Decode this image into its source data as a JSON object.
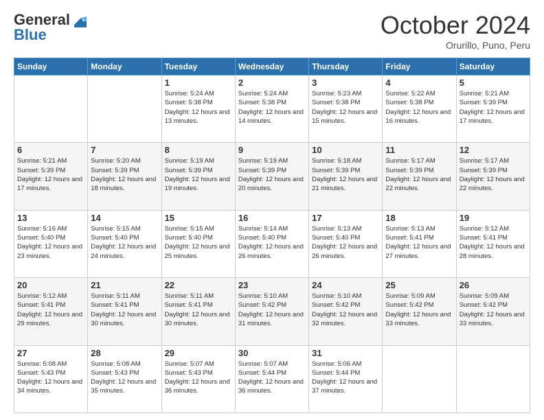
{
  "logo": {
    "line1": "General",
    "line2": "Blue"
  },
  "header": {
    "month": "October 2024",
    "location": "Orurillo, Puno, Peru"
  },
  "weekdays": [
    "Sunday",
    "Monday",
    "Tuesday",
    "Wednesday",
    "Thursday",
    "Friday",
    "Saturday"
  ],
  "weeks": [
    [
      {
        "day": "",
        "info": ""
      },
      {
        "day": "",
        "info": ""
      },
      {
        "day": "1",
        "info": "Sunrise: 5:24 AM\nSunset: 5:38 PM\nDaylight: 12 hours and 13 minutes."
      },
      {
        "day": "2",
        "info": "Sunrise: 5:24 AM\nSunset: 5:38 PM\nDaylight: 12 hours and 14 minutes."
      },
      {
        "day": "3",
        "info": "Sunrise: 5:23 AM\nSunset: 5:38 PM\nDaylight: 12 hours and 15 minutes."
      },
      {
        "day": "4",
        "info": "Sunrise: 5:22 AM\nSunset: 5:38 PM\nDaylight: 12 hours and 16 minutes."
      },
      {
        "day": "5",
        "info": "Sunrise: 5:21 AM\nSunset: 5:39 PM\nDaylight: 12 hours and 17 minutes."
      }
    ],
    [
      {
        "day": "6",
        "info": "Sunrise: 5:21 AM\nSunset: 5:39 PM\nDaylight: 12 hours and 17 minutes."
      },
      {
        "day": "7",
        "info": "Sunrise: 5:20 AM\nSunset: 5:39 PM\nDaylight: 12 hours and 18 minutes."
      },
      {
        "day": "8",
        "info": "Sunrise: 5:19 AM\nSunset: 5:39 PM\nDaylight: 12 hours and 19 minutes."
      },
      {
        "day": "9",
        "info": "Sunrise: 5:19 AM\nSunset: 5:39 PM\nDaylight: 12 hours and 20 minutes."
      },
      {
        "day": "10",
        "info": "Sunrise: 5:18 AM\nSunset: 5:39 PM\nDaylight: 12 hours and 21 minutes."
      },
      {
        "day": "11",
        "info": "Sunrise: 5:17 AM\nSunset: 5:39 PM\nDaylight: 12 hours and 22 minutes."
      },
      {
        "day": "12",
        "info": "Sunrise: 5:17 AM\nSunset: 5:39 PM\nDaylight: 12 hours and 22 minutes."
      }
    ],
    [
      {
        "day": "13",
        "info": "Sunrise: 5:16 AM\nSunset: 5:40 PM\nDaylight: 12 hours and 23 minutes."
      },
      {
        "day": "14",
        "info": "Sunrise: 5:15 AM\nSunset: 5:40 PM\nDaylight: 12 hours and 24 minutes."
      },
      {
        "day": "15",
        "info": "Sunrise: 5:15 AM\nSunset: 5:40 PM\nDaylight: 12 hours and 25 minutes."
      },
      {
        "day": "16",
        "info": "Sunrise: 5:14 AM\nSunset: 5:40 PM\nDaylight: 12 hours and 26 minutes."
      },
      {
        "day": "17",
        "info": "Sunrise: 5:13 AM\nSunset: 5:40 PM\nDaylight: 12 hours and 26 minutes."
      },
      {
        "day": "18",
        "info": "Sunrise: 5:13 AM\nSunset: 5:41 PM\nDaylight: 12 hours and 27 minutes."
      },
      {
        "day": "19",
        "info": "Sunrise: 5:12 AM\nSunset: 5:41 PM\nDaylight: 12 hours and 28 minutes."
      }
    ],
    [
      {
        "day": "20",
        "info": "Sunrise: 5:12 AM\nSunset: 5:41 PM\nDaylight: 12 hours and 29 minutes."
      },
      {
        "day": "21",
        "info": "Sunrise: 5:11 AM\nSunset: 5:41 PM\nDaylight: 12 hours and 30 minutes."
      },
      {
        "day": "22",
        "info": "Sunrise: 5:11 AM\nSunset: 5:41 PM\nDaylight: 12 hours and 30 minutes."
      },
      {
        "day": "23",
        "info": "Sunrise: 5:10 AM\nSunset: 5:42 PM\nDaylight: 12 hours and 31 minutes."
      },
      {
        "day": "24",
        "info": "Sunrise: 5:10 AM\nSunset: 5:42 PM\nDaylight: 12 hours and 32 minutes."
      },
      {
        "day": "25",
        "info": "Sunrise: 5:09 AM\nSunset: 5:42 PM\nDaylight: 12 hours and 33 minutes."
      },
      {
        "day": "26",
        "info": "Sunrise: 5:09 AM\nSunset: 5:42 PM\nDaylight: 12 hours and 33 minutes."
      }
    ],
    [
      {
        "day": "27",
        "info": "Sunrise: 5:08 AM\nSunset: 5:43 PM\nDaylight: 12 hours and 34 minutes."
      },
      {
        "day": "28",
        "info": "Sunrise: 5:08 AM\nSunset: 5:43 PM\nDaylight: 12 hours and 35 minutes."
      },
      {
        "day": "29",
        "info": "Sunrise: 5:07 AM\nSunset: 5:43 PM\nDaylight: 12 hours and 36 minutes."
      },
      {
        "day": "30",
        "info": "Sunrise: 5:07 AM\nSunset: 5:44 PM\nDaylight: 12 hours and 36 minutes."
      },
      {
        "day": "31",
        "info": "Sunrise: 5:06 AM\nSunset: 5:44 PM\nDaylight: 12 hours and 37 minutes."
      },
      {
        "day": "",
        "info": ""
      },
      {
        "day": "",
        "info": ""
      }
    ]
  ]
}
